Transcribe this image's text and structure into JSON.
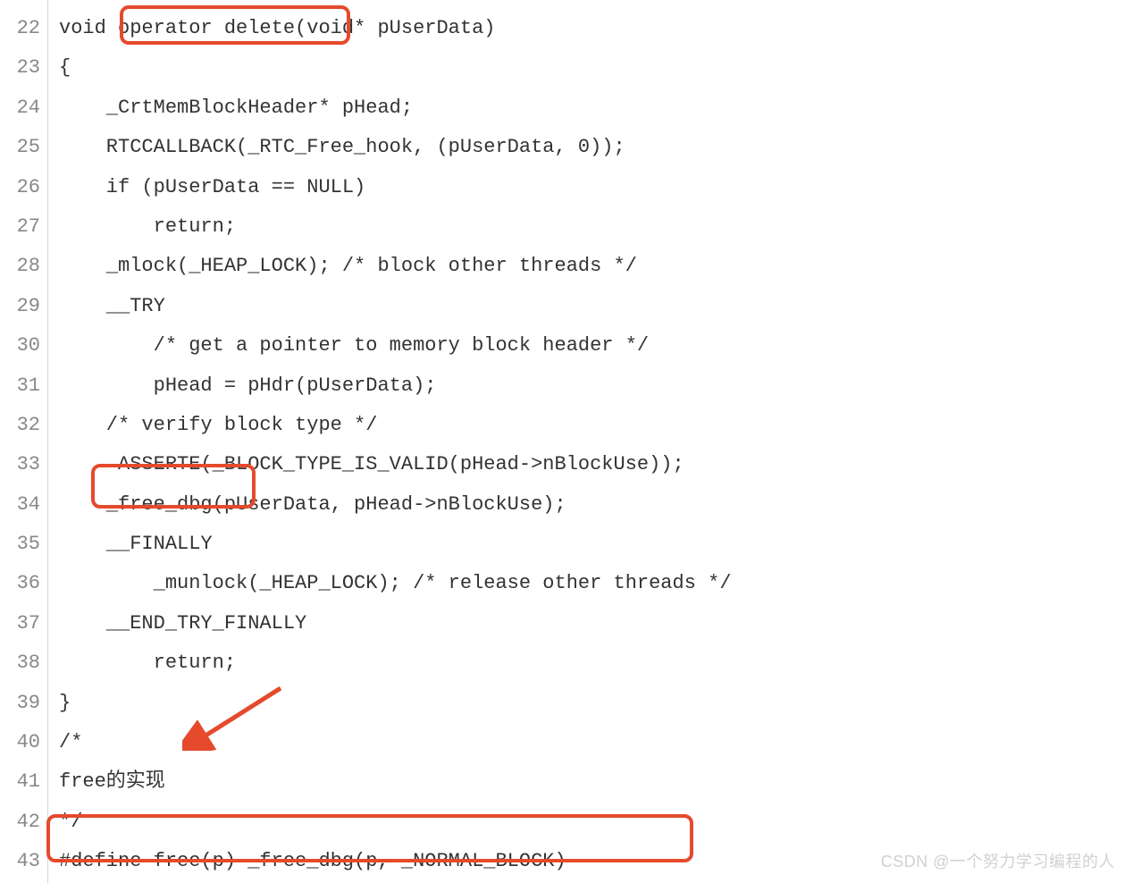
{
  "lines": [
    {
      "num": "22",
      "text": "void operator delete(void* pUserData)"
    },
    {
      "num": "23",
      "text": "{"
    },
    {
      "num": "24",
      "text": "    _CrtMemBlockHeader* pHead;"
    },
    {
      "num": "25",
      "text": "    RTCCALLBACK(_RTC_Free_hook, (pUserData, 0));"
    },
    {
      "num": "26",
      "text": "    if (pUserData == NULL)"
    },
    {
      "num": "27",
      "text": "        return;"
    },
    {
      "num": "28",
      "text": "    _mlock(_HEAP_LOCK); /* block other threads */"
    },
    {
      "num": "29",
      "text": "    __TRY"
    },
    {
      "num": "30",
      "text": "        /* get a pointer to memory block header */"
    },
    {
      "num": "31",
      "text": "        pHead = pHdr(pUserData);"
    },
    {
      "num": "32",
      "text": "    /* verify block type */"
    },
    {
      "num": "33",
      "text": "     ASSERTE(_BLOCK_TYPE_IS_VALID(pHead->nBlockUse));"
    },
    {
      "num": "34",
      "text": "    _free_dbg(pUserData, pHead->nBlockUse);"
    },
    {
      "num": "35",
      "text": "    __FINALLY"
    },
    {
      "num": "36",
      "text": "        _munlock(_HEAP_LOCK); /* release other threads */"
    },
    {
      "num": "37",
      "text": "    __END_TRY_FINALLY"
    },
    {
      "num": "38",
      "text": "        return;"
    },
    {
      "num": "39",
      "text": "}"
    },
    {
      "num": "40",
      "text": "/*"
    },
    {
      "num": "41",
      "text": "free的实现"
    },
    {
      "num": "42",
      "text": "*/"
    },
    {
      "num": "43",
      "text": "#define free(p) _free_dbg(p, _NORMAL_BLOCK)"
    }
  ],
  "watermark": "CSDN @一个努力学习编程的人",
  "highlight_color": "#E54A2C"
}
